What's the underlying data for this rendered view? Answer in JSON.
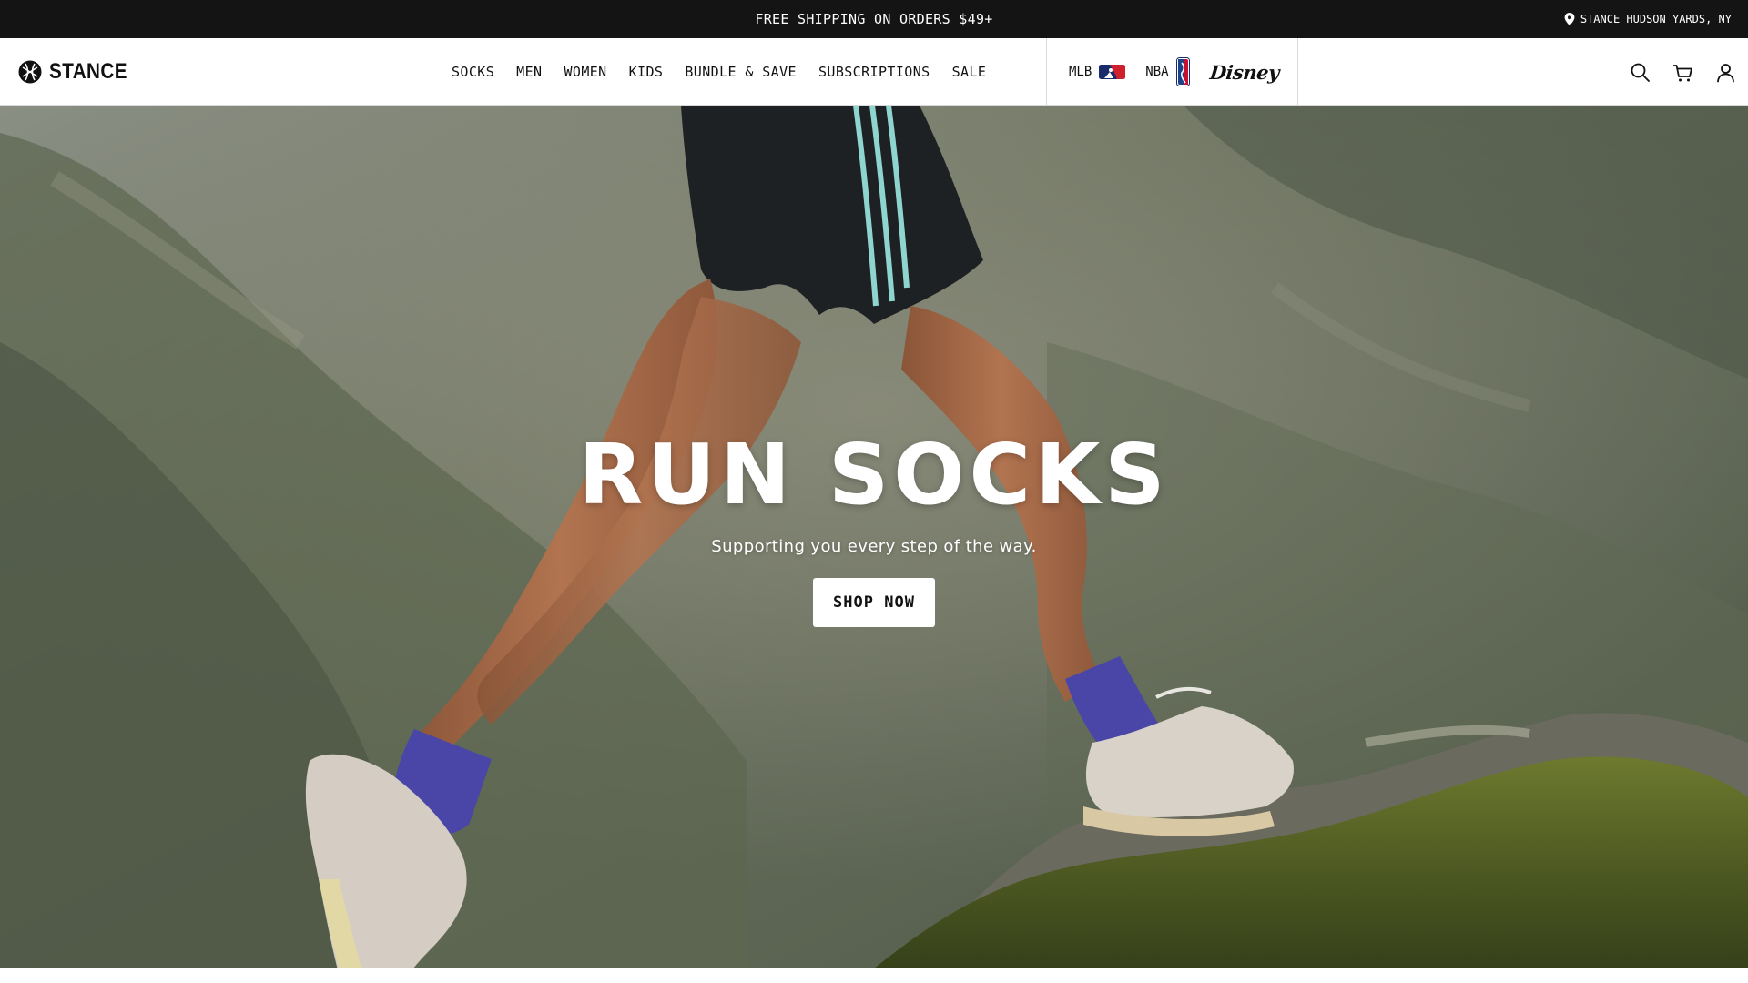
{
  "announcement": {
    "text": "FREE SHIPPING ON ORDERS $49+",
    "store_label": "STANCE HUDSON YARDS, NY",
    "store_icon": "location-pin-icon"
  },
  "header": {
    "logo_text": "STANCE",
    "logo_icon": "stance-logo-icon",
    "nav": [
      "SOCKS",
      "MEN",
      "WOMEN",
      "KIDS",
      "BUNDLE & SAVE",
      "SUBSCRIPTIONS",
      "SALE"
    ],
    "partners": {
      "mlb": "MLB",
      "nba": "NBA",
      "disney": "Disney"
    },
    "icons": [
      "search-icon",
      "cart-icon",
      "account-icon"
    ]
  },
  "hero": {
    "title": "RUN SOCKS",
    "subtitle": "Supporting you every step of the way.",
    "cta": "SHOP NOW"
  },
  "colors": {
    "announcement_bg": "#141414",
    "sock": "#4a46a8",
    "button_bg": "#ffffff"
  }
}
